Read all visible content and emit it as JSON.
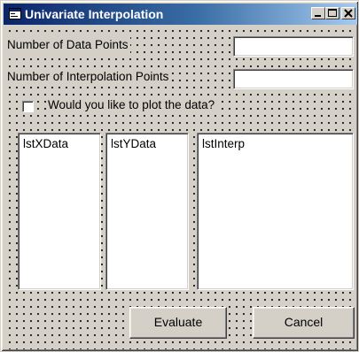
{
  "window": {
    "title": "Univariate Interpolation",
    "icon": "form-icon",
    "controls": {
      "minimize": "minimize-icon",
      "maximize": "maximize-icon",
      "close": "close-icon"
    },
    "colors": {
      "titlebar_start": "#0a246a",
      "titlebar_end": "#a6caf0",
      "face": "#d4d0c8"
    }
  },
  "form": {
    "num_data_points_label": "Number of Data Points",
    "num_data_points_value": "",
    "num_interp_points_label": "Number of Interpolation Points",
    "num_interp_points_value": "",
    "plot_checkbox_label": "Would you like to plot the data?",
    "plot_checkbox_checked": false
  },
  "lists": {
    "x_data": {
      "name": "lstXData"
    },
    "y_data": {
      "name": "lstYData"
    },
    "interp": {
      "name": "lstInterp"
    }
  },
  "buttons": {
    "evaluate": "Evaluate",
    "cancel": "Cancel"
  }
}
